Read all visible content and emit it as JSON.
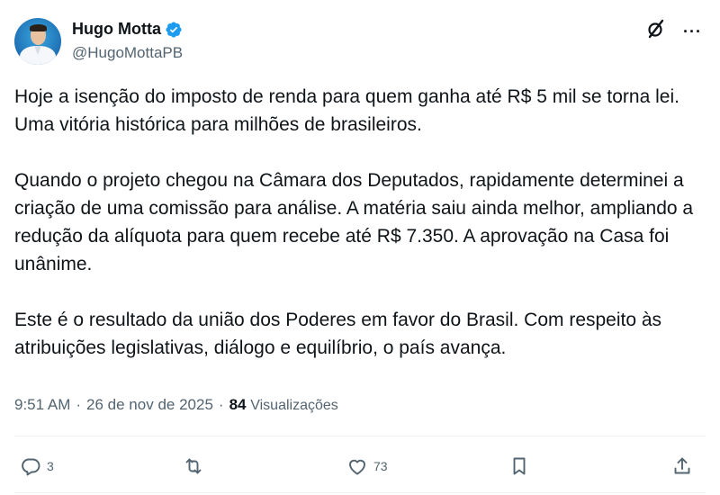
{
  "author": {
    "name": "Hugo Motta",
    "handle": "@HugoMottaPB",
    "verified": true
  },
  "icons": {
    "grok": "grok-icon",
    "more": "more-dots-icon",
    "reply": "reply-icon",
    "retweet": "retweet-icon",
    "like": "heart-icon",
    "bookmark": "bookmark-icon",
    "share": "share-icon"
  },
  "colors": {
    "verified": "#1d9bf0",
    "text": "#0f1419",
    "secondary": "#536471"
  },
  "tweet": {
    "paragraphs": [
      "Hoje a isenção do imposto de renda para quem ganha até R$ 5 mil se torna lei. Uma vitória histórica para milhões de brasileiros.",
      "Quando o projeto chegou na Câmara dos Deputados, rapidamente determinei a criação de uma comissão para análise. A matéria saiu ainda melhor, ampliando a redução da alíquota para quem recebe até R$ 7.350. A aprovação na Casa foi unânime.",
      "Este é o resultado da união dos Poderes em favor do Brasil. Com respeito às atribuições legislativas, diálogo e equilíbrio, o país avança."
    ]
  },
  "meta": {
    "time": "9:51 AM",
    "separator": "·",
    "date": "26 de nov de 2025",
    "views_count": "84",
    "views_label": "Visualizações"
  },
  "more_label": "···",
  "actions": {
    "reply_count": "3",
    "retweet_count": "",
    "like_count": "73"
  }
}
